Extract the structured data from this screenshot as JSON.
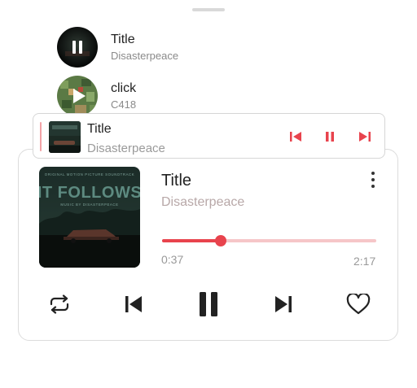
{
  "queue": [
    {
      "title": "Title",
      "artist": "Disasterpeace",
      "thumb_icon": "pause-icon"
    },
    {
      "title": "click",
      "artist": "C418",
      "thumb_icon": "play-icon"
    }
  ],
  "mini_player": {
    "title": "Title",
    "artist": "Disasterpeace",
    "controls": [
      "skip-previous-icon",
      "pause-icon",
      "skip-next-icon"
    ]
  },
  "now_playing": {
    "title": "Title",
    "artist": "Disasterpeace",
    "elapsed": "0:37",
    "duration": "2:17",
    "progress": 0.275,
    "album_art": {
      "header": "ORIGINAL MOTION PICTURE SOUNDTRACK",
      "title": "IT FOLLOWS",
      "subtitle": "MUSIC BY DISASTERPEACE"
    }
  },
  "controls": [
    "repeat-icon",
    "skip-previous-icon",
    "pause-icon",
    "skip-next-icon",
    "heart-icon"
  ],
  "colors": {
    "accent": "#e8434d",
    "accent_light": "#f6c6c8",
    "text_primary": "#222222",
    "text_secondary": "#9a9a9a"
  }
}
